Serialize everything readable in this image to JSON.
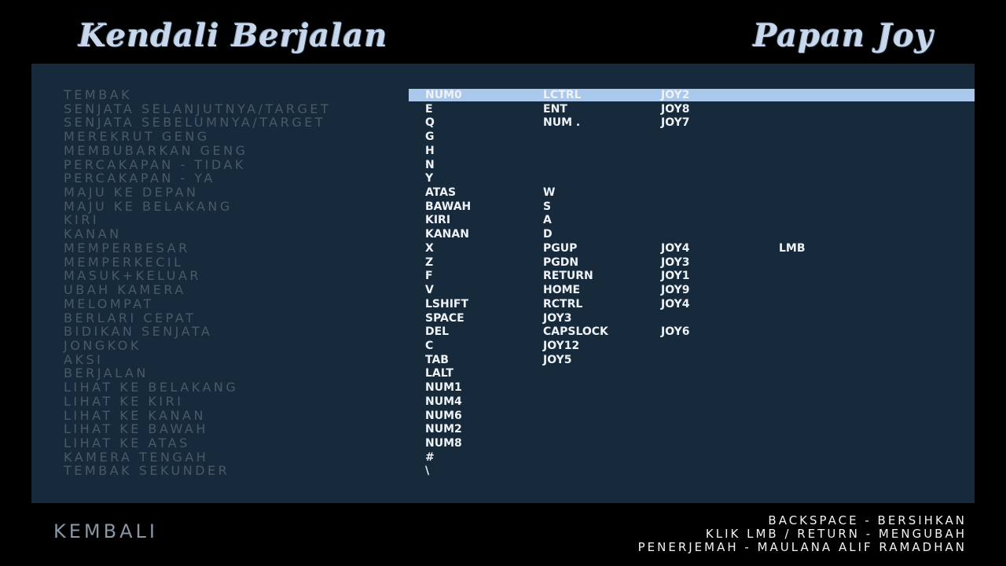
{
  "header": {
    "left_title": "Kendali Berjalan",
    "right_title": "Papan Joy"
  },
  "selected_row": 0,
  "bindings": [
    {
      "action": "TEMBAK",
      "keys": [
        "NUM0",
        "LCTRL",
        "JOY2",
        ""
      ]
    },
    {
      "action": "SENJATA SELANJUTNYA/TARGET",
      "keys": [
        "E",
        "ENT",
        "JOY8",
        ""
      ]
    },
    {
      "action": "SENJATA SEBELUMNYA/TARGET",
      "keys": [
        "Q",
        "NUM .",
        "JOY7",
        ""
      ]
    },
    {
      "action": "MEREKRUT GENG",
      "keys": [
        "G",
        "",
        "",
        ""
      ]
    },
    {
      "action": "MEMBUBARKAN GENG",
      "keys": [
        "H",
        "",
        "",
        ""
      ]
    },
    {
      "action": "PERCAKAPAN - TIDAK",
      "keys": [
        "N",
        "",
        "",
        ""
      ]
    },
    {
      "action": "PERCAKAPAN - YA",
      "keys": [
        "Y",
        "",
        "",
        ""
      ]
    },
    {
      "action": "MAJU KE DEPAN",
      "keys": [
        "ATAS",
        "W",
        "",
        ""
      ]
    },
    {
      "action": "MAJU KE BELAKANG",
      "keys": [
        "BAWAH",
        "S",
        "",
        ""
      ]
    },
    {
      "action": "KIRI",
      "keys": [
        "KIRI",
        "A",
        "",
        ""
      ]
    },
    {
      "action": "KANAN",
      "keys": [
        "KANAN",
        "D",
        "",
        ""
      ]
    },
    {
      "action": "MEMPERBESAR",
      "keys": [
        "X",
        "PGUP",
        "JOY4",
        "LMB"
      ]
    },
    {
      "action": "MEMPERKECIL",
      "keys": [
        "Z",
        "PGDN",
        "JOY3",
        ""
      ]
    },
    {
      "action": "MASUK+KELUAR",
      "keys": [
        "F",
        "RETURN",
        "JOY1",
        ""
      ]
    },
    {
      "action": "UBAH KAMERA",
      "keys": [
        "V",
        "HOME",
        "JOY9",
        ""
      ]
    },
    {
      "action": "MELOMPAT",
      "keys": [
        "LSHIFT",
        "RCTRL",
        "JOY4",
        ""
      ]
    },
    {
      "action": "BERLARI CEPAT",
      "keys": [
        "SPACE",
        "JOY3",
        "",
        ""
      ]
    },
    {
      "action": "BIDIKAN SENJATA",
      "keys": [
        "DEL",
        "CAPSLOCK",
        "JOY6",
        ""
      ]
    },
    {
      "action": "JONGKOK",
      "keys": [
        "C",
        "JOY12",
        "",
        ""
      ]
    },
    {
      "action": "AKSI",
      "keys": [
        "TAB",
        "JOY5",
        "",
        ""
      ]
    },
    {
      "action": "BERJALAN",
      "keys": [
        "LALT",
        "",
        "",
        ""
      ]
    },
    {
      "action": "LIHAT KE BELAKANG",
      "keys": [
        "NUM1",
        "",
        "",
        ""
      ]
    },
    {
      "action": "LIHAT KE KIRI",
      "keys": [
        "NUM4",
        "",
        "",
        ""
      ]
    },
    {
      "action": "LIHAT KE KANAN",
      "keys": [
        "NUM6",
        "",
        "",
        ""
      ]
    },
    {
      "action": "LIHAT KE BAWAH",
      "keys": [
        "NUM2",
        "",
        "",
        ""
      ]
    },
    {
      "action": "LIHAT KE ATAS",
      "keys": [
        "NUM8",
        "",
        "",
        ""
      ]
    },
    {
      "action": "KAMERA TENGAH",
      "keys": [
        "#",
        "",
        "",
        ""
      ]
    },
    {
      "action": "TEMBAK SEKUNDER",
      "keys": [
        "\\",
        "",
        "",
        ""
      ]
    }
  ],
  "footer": {
    "back_label": "KEMBALI",
    "hints": [
      "BACKSPACE - BERSIHKAN",
      "KLIK LMB / RETURN - MENGUBAH",
      "PENERJEMAH - MAULANA ALIF RAMADHAN"
    ]
  },
  "colors": {
    "panel": "#172a3c",
    "highlight": "#aac8ec",
    "action_text": "#4a5968",
    "key_text": "#eef2f6"
  }
}
